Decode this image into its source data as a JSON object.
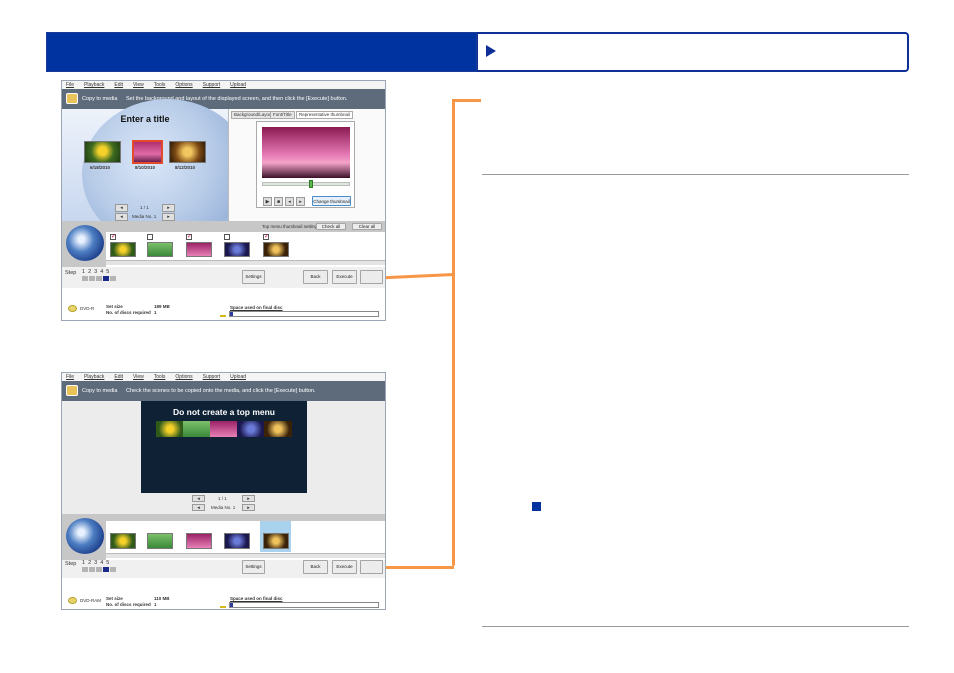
{
  "window1": {
    "menu": [
      "File",
      "Playback",
      "Edit",
      "View",
      "Tools",
      "Options",
      "Support",
      "Upload"
    ],
    "title": "Copy to media",
    "instruction": "Set the background and layout of the displayed screen, and then click the [Execute] button.",
    "preview_title": "Enter a title",
    "preview_dates": [
      "6/18/2010",
      "8/10/2010",
      "8/12/2010"
    ],
    "page_indicator": "1 / 1",
    "media_label": "Media No. 1",
    "tabs": [
      "Background/Layout",
      "Font/Title",
      "Representative thumbnail"
    ],
    "thumb_settings_label": "Top menu thumbnail settings",
    "check_all": "Check all",
    "clear_all": "Clear all",
    "change_thumbnail": "Change thumbnail",
    "step_label": "Step",
    "steps": [
      "1",
      "2",
      "3",
      "4",
      "5"
    ],
    "settings": "Settings",
    "back": "Back",
    "execute": "Execute",
    "total_size_label": "Set size",
    "total_size_value": "189 MB",
    "discs_label": "No. of discs required",
    "discs_value": "1",
    "space_label": "Space used on final disc",
    "disc_type": "DVD-R"
  },
  "window2": {
    "menu": [
      "File",
      "Playback",
      "Edit",
      "View",
      "Tools",
      "Options",
      "Support",
      "Upload"
    ],
    "title": "Copy to media",
    "instruction": "Check the scenes to be copied onto the media, and click the [Execute] button.",
    "preview_title": "Do not create a top menu",
    "page_indicator": "1 / 1",
    "media_label": "Media No. 1",
    "step_label": "Step",
    "steps": [
      "1",
      "2",
      "3",
      "4",
      "5"
    ],
    "settings": "Settings",
    "back": "Back",
    "execute": "Execute",
    "total_size_label": "Set size",
    "total_size_value": "110 MB",
    "discs_label": "No. of discs required",
    "discs_value": "1",
    "space_label": "Space used on final disc",
    "disc_type": "DVD-RAM"
  },
  "colors": {
    "header_blue": "#0033a0",
    "callout_orange": "#f79646",
    "marker_blue": "#0033a0"
  },
  "icons": [
    "play-right-arrow-icon",
    "marker-square-icon"
  ]
}
